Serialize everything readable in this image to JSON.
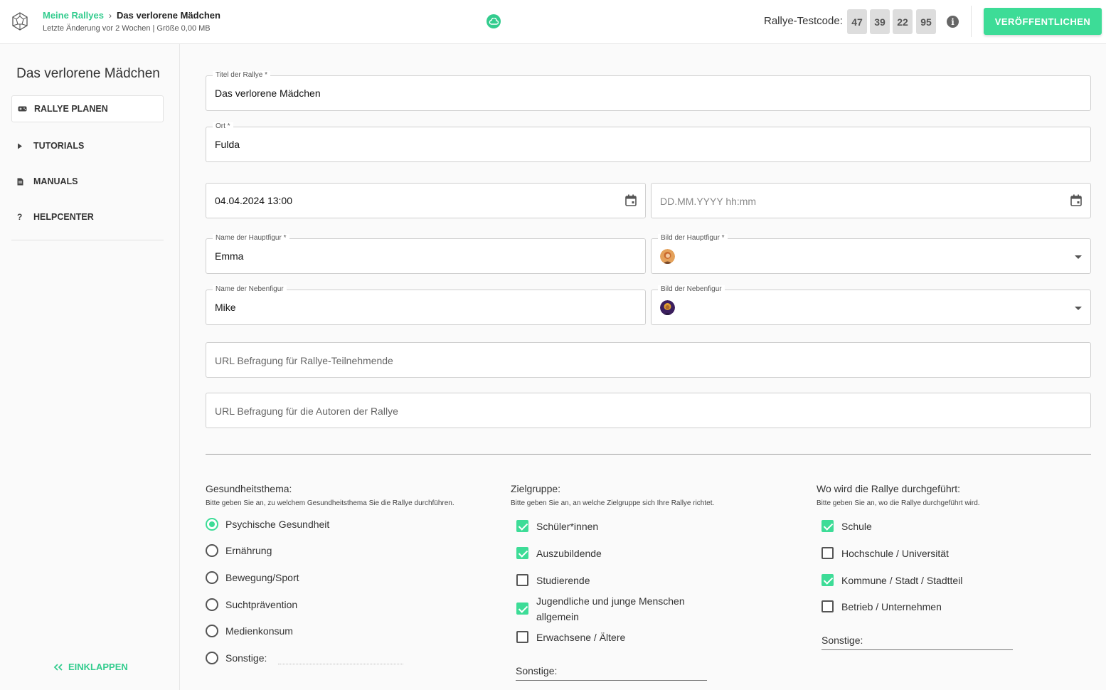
{
  "header": {
    "breadcrumb_root": "Meine Rallyes",
    "breadcrumb_separator": "›",
    "breadcrumb_current": "Das verlorene Mädchen",
    "meta": "Letzte Änderung vor 2 Wochen | Größe 0,00 MB",
    "testcode_label": "Rallye-Testcode:",
    "testcode": [
      "47",
      "39",
      "22",
      "95"
    ],
    "info_glyph": "i",
    "publish_label": "VERÖFFENTLICHEN",
    "accent_color": "#3ddc97"
  },
  "sidebar": {
    "title": "Das verlorene Mädchen",
    "items": [
      {
        "label": "RALLYE PLANEN",
        "icon": "gamepad-icon",
        "active": true
      },
      {
        "label": "TUTORIALS",
        "icon": "play-icon",
        "active": false
      },
      {
        "label": "MANUALS",
        "icon": "document-icon",
        "active": false
      },
      {
        "label": "HELPCENTER",
        "icon": "question-icon",
        "active": false
      }
    ],
    "collapse_label": "EINKLAPPEN"
  },
  "form": {
    "title": {
      "label": "Titel der Rallye *",
      "value": "Das verlorene Mädchen"
    },
    "ort": {
      "label": "Ort *",
      "value": "Fulda"
    },
    "start_date": {
      "value": "04.04.2024 13:00"
    },
    "end_date": {
      "placeholder": "DD.MM.YYYY hh:mm"
    },
    "hauptfigur_name": {
      "label": "Name der Hauptfigur *",
      "value": "Emma"
    },
    "hauptfigur_bild": {
      "label": "Bild der Hauptfigur *"
    },
    "nebenfigur_name": {
      "label": "Name der Nebenfigur",
      "value": "Mike"
    },
    "nebenfigur_bild": {
      "label": "Bild der Nebenfigur"
    },
    "url_teilnehmende": {
      "placeholder": "URL Befragung für Rallye-Teilnehmende"
    },
    "url_autoren": {
      "placeholder": "URL Befragung für die Autoren der Rallye"
    }
  },
  "gesundheitsthema": {
    "title": "Gesundheitsthema:",
    "hint": "Bitte geben Sie an, zu welchem Gesundheitsthema Sie die Rallye durchführen.",
    "options": [
      {
        "label": "Psychische Gesundheit",
        "checked": true
      },
      {
        "label": "Ernährung",
        "checked": false
      },
      {
        "label": "Bewegung/Sport",
        "checked": false
      },
      {
        "label": "Suchtprävention",
        "checked": false
      },
      {
        "label": "Medienkonsum",
        "checked": false
      },
      {
        "label": "Sonstige:",
        "checked": false
      }
    ]
  },
  "zielgruppe": {
    "title": "Zielgruppe:",
    "hint": "Bitte geben Sie an, an welche Zielgruppe sich Ihre Rallye richtet.",
    "options": [
      {
        "label": "Schüler*innen",
        "checked": true
      },
      {
        "label": "Auszubildende",
        "checked": true
      },
      {
        "label": "Studierende",
        "checked": false
      },
      {
        "label": "Jugendliche und junge Menschen allgemein",
        "checked": true
      },
      {
        "label": "Erwachsene / Ältere",
        "checked": false
      }
    ],
    "sonstige_label": "Sonstige:"
  },
  "ort_durchfuehrung": {
    "title": "Wo wird die Rallye durchgeführt:",
    "hint": "Bitte geben Sie an, wo die Rallye durchgeführt wird.",
    "options": [
      {
        "label": "Schule",
        "checked": true
      },
      {
        "label": "Hochschule / Universität",
        "checked": false
      },
      {
        "label": "Kommune / Stadt / Stadtteil",
        "checked": true
      },
      {
        "label": "Betrieb / Unternehmen",
        "checked": false
      }
    ],
    "sonstige_label": "Sonstige:"
  }
}
